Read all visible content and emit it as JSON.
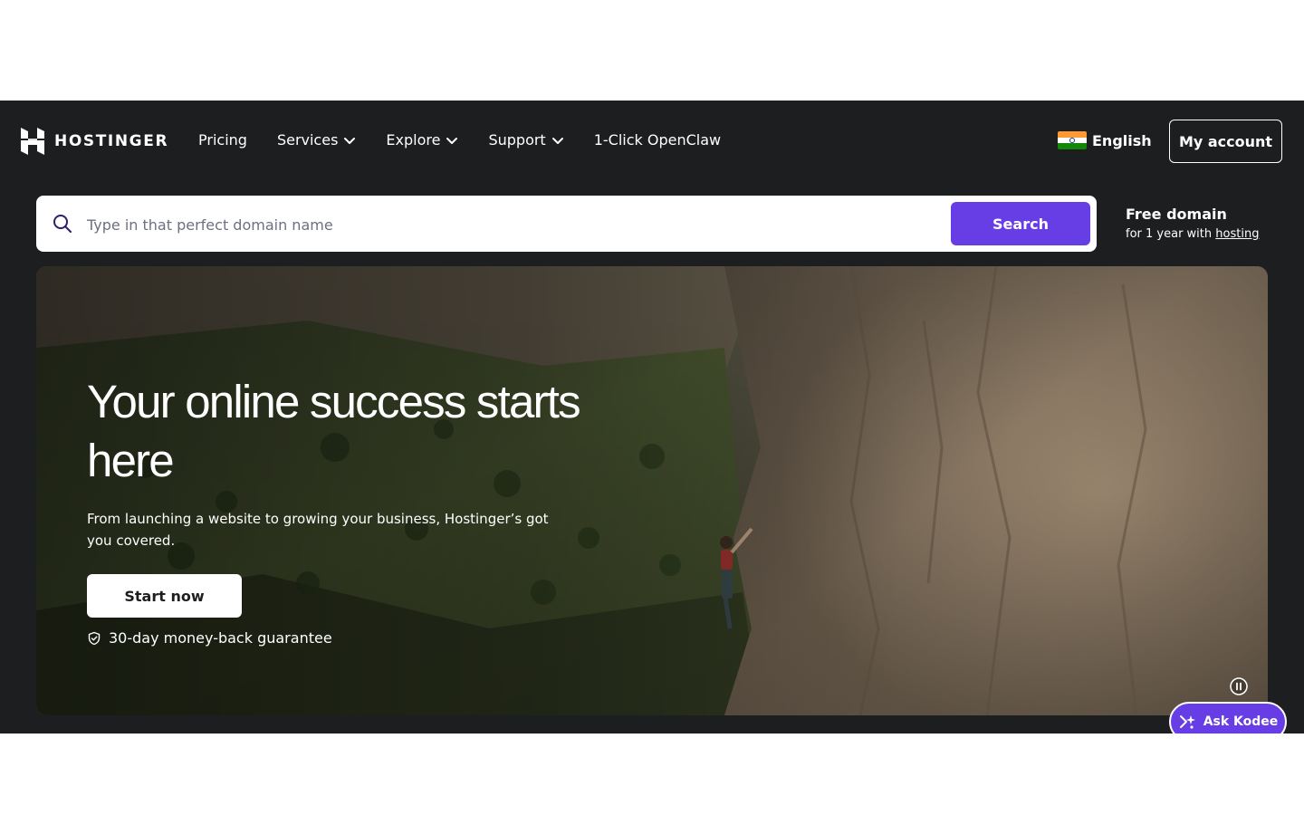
{
  "header": {
    "brand": "HOSTINGER",
    "nav": [
      {
        "label": "Pricing",
        "dropdown": false
      },
      {
        "label": "Services",
        "dropdown": true
      },
      {
        "label": "Explore",
        "dropdown": true
      },
      {
        "label": "Support",
        "dropdown": true
      },
      {
        "label": "1-Click OpenClaw",
        "dropdown": false
      }
    ],
    "language": "English",
    "language_flag": "india-flag-icon",
    "account_label": "My account"
  },
  "search": {
    "placeholder": "Type in that perfect domain name",
    "value": "",
    "button_label": "Search"
  },
  "promo": {
    "title": "Free domain",
    "subtitle_prefix": "for 1 year with",
    "subtitle_link": "hosting"
  },
  "hero": {
    "title": "Your online success starts here",
    "subtitle": "From launching a website to growing your business, Hostinger’s got you covered.",
    "cta_label": "Start now",
    "guarantee": "30-day money-back guarantee"
  },
  "assistant": {
    "label": "Ask Kodee"
  },
  "colors": {
    "page_background": "#1d1e20",
    "accent": "#673de6",
    "text_on_dark": "#ffffff"
  }
}
